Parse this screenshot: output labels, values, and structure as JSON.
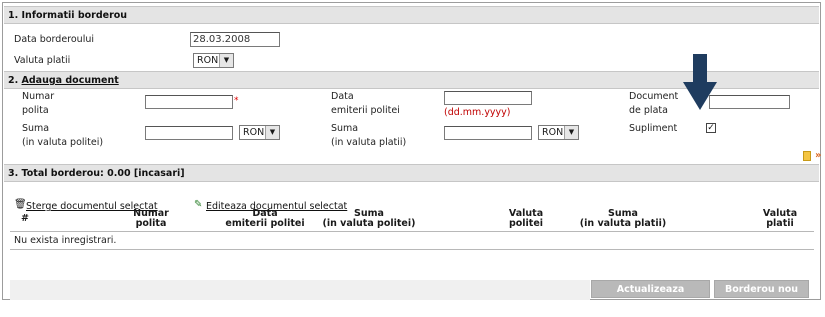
{
  "section1": {
    "title": "1. Informatii borderou",
    "data_label": "Data borderoului",
    "data_value": "28.03.2008",
    "valuta_label": "Valuta platii",
    "valuta_value": "RON"
  },
  "section2": {
    "title_prefix": "2. ",
    "title_link": "Adauga document",
    "numar_polita_l1": "Numar",
    "numar_polita_l2": "polita",
    "required_mark": "*",
    "data_emiterii_l1": "Data",
    "data_emiterii_l2": "emiterii politei",
    "date_hint": "(dd.mm.yyyy)",
    "document_l1": "Document",
    "document_l2": "de plata",
    "suma_l1": "Suma",
    "suma_l2": "(in valuta politei)",
    "suma_valuta_value": "RON",
    "suma2_l1": "Suma",
    "suma2_l2": "(in valuta platii)",
    "suma2_valuta_value": "RON",
    "supliment_label": "Supliment",
    "supliment_checked": "✓"
  },
  "section3": {
    "title": "3. Total borderou: 0.00 [incasari]",
    "delete_link": "Sterge documentul selectat",
    "edit_link": "Editeaza documentul selectat",
    "columns": {
      "c0": "#",
      "c1_l1": "Numar",
      "c1_l2": "polita",
      "c2_l1": "Data",
      "c2_l2": "emiterii politei",
      "c3_l1": "Suma",
      "c3_l2": "(in valuta politei)",
      "c4_l1": "Valuta",
      "c4_l2": "politei",
      "c5_l1": "Suma",
      "c5_l2": "(in valuta platii)",
      "c6_l1": "Valuta",
      "c6_l2": "platii"
    },
    "empty_text": "Nu exista inregistrari."
  },
  "buttons": {
    "update": "Actualizeaza borderou",
    "new": "Borderou nou"
  },
  "colors": {
    "header_bg": "#e4e4e4",
    "arrow": "#1f3c5f",
    "hint_red": "#c00000",
    "button_bg": "#b9b9b9"
  }
}
